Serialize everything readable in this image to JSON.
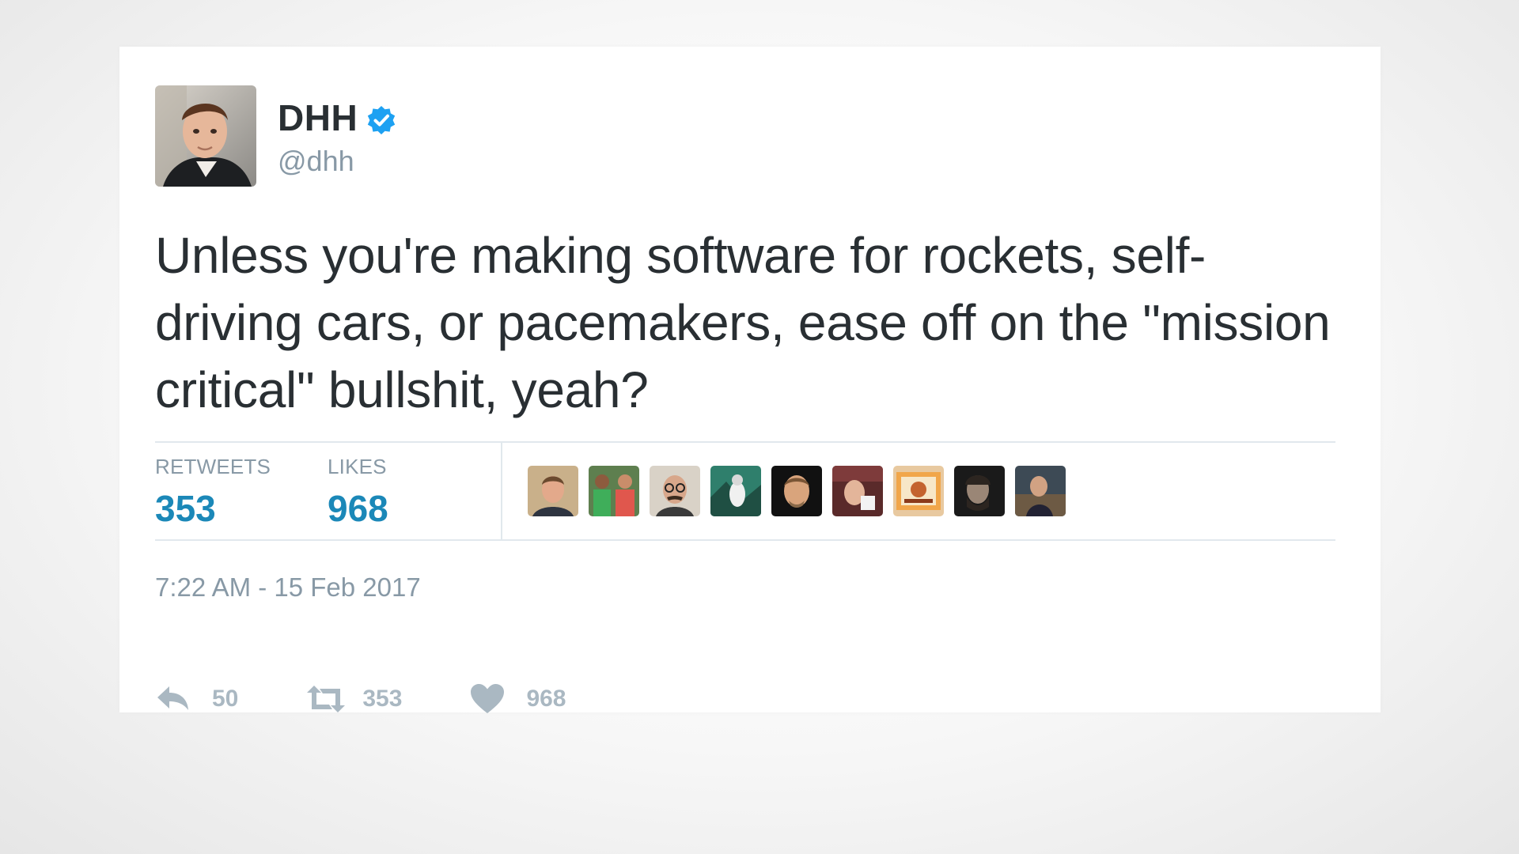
{
  "tweet": {
    "display_name": "DHH",
    "verified": true,
    "handle": "@dhh",
    "text": "Unless you're making software for rockets, self-driving cars, or pacemakers, ease off on the \"mission critical\" bullshit, yeah?",
    "timestamp": "7:22 AM - 15 Feb 2017"
  },
  "stats": {
    "retweets_label": "RETWEETS",
    "retweets_value": "353",
    "likes_label": "LIKES",
    "likes_value": "968"
  },
  "likers": [
    {
      "icon": "user-avatar-icon"
    },
    {
      "icon": "user-avatar-icon"
    },
    {
      "icon": "user-avatar-icon"
    },
    {
      "icon": "user-avatar-icon"
    },
    {
      "icon": "user-avatar-icon"
    },
    {
      "icon": "user-avatar-icon"
    },
    {
      "icon": "user-avatar-icon"
    },
    {
      "icon": "user-avatar-icon"
    },
    {
      "icon": "user-avatar-icon"
    }
  ],
  "actions": {
    "reply_count": "50",
    "retweet_count": "353",
    "like_count": "968"
  },
  "colors": {
    "verified": "#1da1f2",
    "stat_value": "#1b88b8",
    "muted": "#8899a6",
    "action": "#aab8c2",
    "text": "#292f33"
  }
}
